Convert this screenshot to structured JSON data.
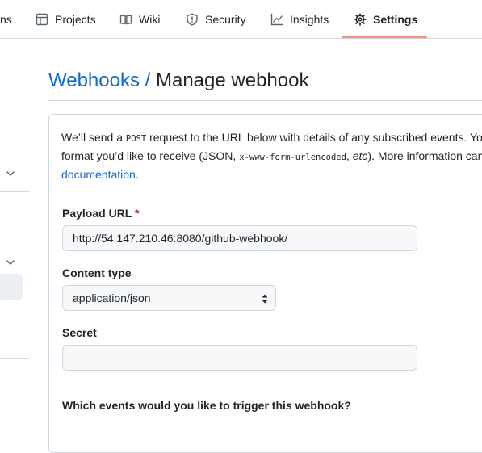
{
  "nav": {
    "tabs": [
      {
        "label": "ns",
        "icon": "code-icon"
      },
      {
        "label": "Projects",
        "icon": "table-icon"
      },
      {
        "label": "Wiki",
        "icon": "book-icon"
      },
      {
        "label": "Security",
        "icon": "shield-icon"
      },
      {
        "label": "Insights",
        "icon": "graph-icon"
      },
      {
        "label": "Settings",
        "icon": "gear-icon",
        "selected": true
      }
    ]
  },
  "header": {
    "breadcrumb_link": "Webhooks",
    "separator": " / ",
    "title": "Manage webhook"
  },
  "intro": {
    "line1_a": "We’ll send a ",
    "line1_code": "POST",
    "line1_b": " request to the URL below with details of any subscribed events. You",
    "line2_a": "format you’d like to receive (JSON, ",
    "line2_code": "x-www-form-urlencoded",
    "line2_b": ", ",
    "line2_etc": "etc",
    "line2_c": "). More information can",
    "doc_link": "documentation",
    "doc_period": "."
  },
  "form": {
    "payload_url_label": "Payload URL",
    "required_mark": "*",
    "payload_url_value": "http://54.147.210.46:8080/github-webhook/",
    "content_type_label": "Content type",
    "content_type_value": "application/json",
    "secret_label": "Secret",
    "secret_value": "",
    "events_question": "Which events would you like to trigger this webhook?"
  },
  "colors": {
    "accent_link": "#0969da",
    "tab_underline": "#fd8c73",
    "required": "#cf222e"
  }
}
